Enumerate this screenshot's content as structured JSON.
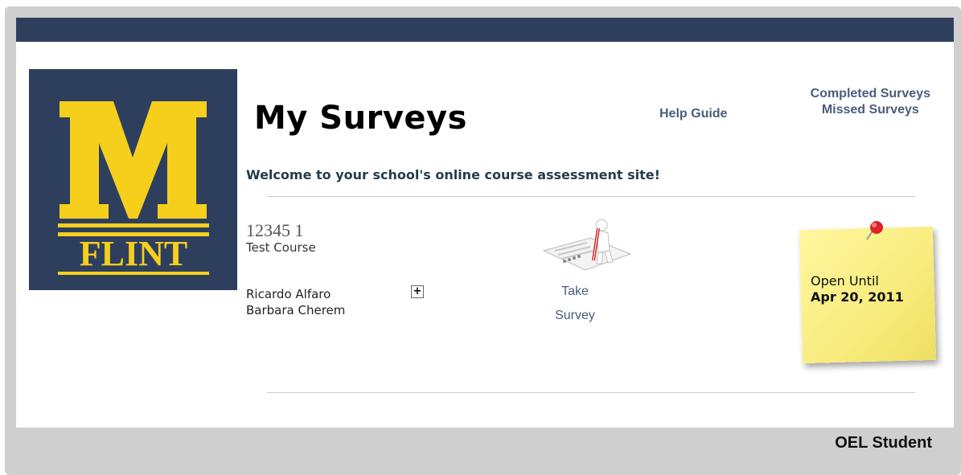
{
  "header": {
    "logo_text_top": "M",
    "logo_text_bottom": "FLINT",
    "title": "My Surveys",
    "help_link": "Help Guide",
    "completed_link": "Completed Surveys",
    "missed_link": "Missed Surveys"
  },
  "welcome": "Welcome to your school's online course assessment site!",
  "course": {
    "code": "12345 1",
    "name": "Test Course",
    "instructors": [
      "Ricardo Alfaro",
      "Barbara Cherem"
    ],
    "expand_symbol": "+",
    "take_line1": "Take",
    "take_line2": "Survey",
    "open_label": "Open Until",
    "open_date": "Apr 20, 2011"
  },
  "footer": {
    "user": "OEL Student"
  },
  "colors": {
    "navy": "#2e3f5e",
    "maize": "#f5cf1c",
    "link": "#4a5d7c",
    "sticky": "#f7ec7d",
    "frame": "#cfcfcf"
  },
  "icons": [
    "block-m-logo",
    "survey-person-icon",
    "push-pin-icon",
    "plus-expand-icon"
  ]
}
